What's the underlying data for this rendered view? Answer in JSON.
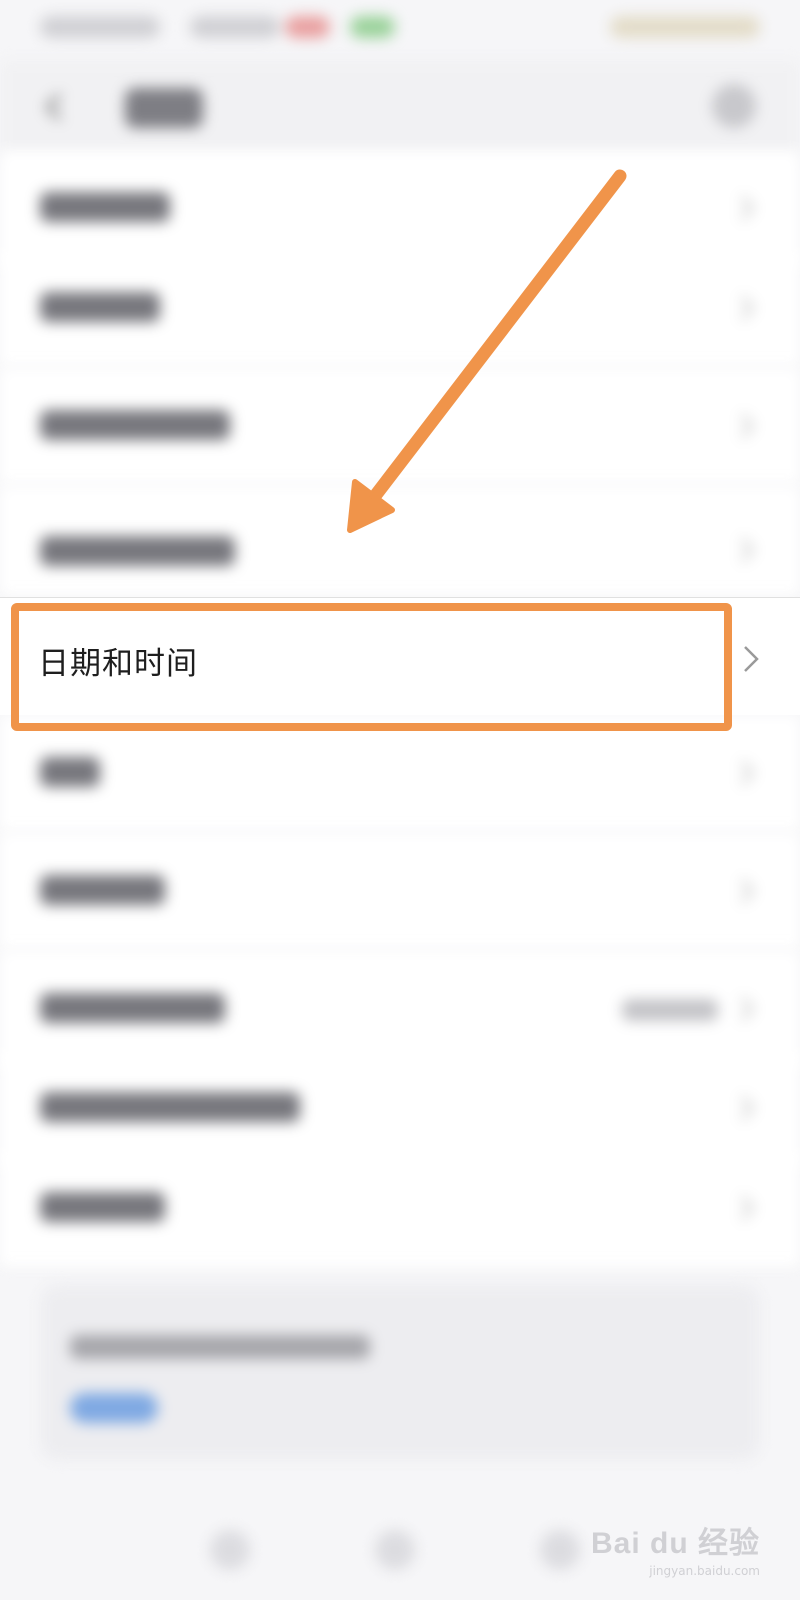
{
  "settings_list": {
    "highlighted_item": {
      "label": "日期和时间"
    }
  },
  "watermark": {
    "main": "Bai du 经验",
    "url": "jingyan.baidu.com"
  },
  "annotation": {
    "color": "#f0944a"
  }
}
